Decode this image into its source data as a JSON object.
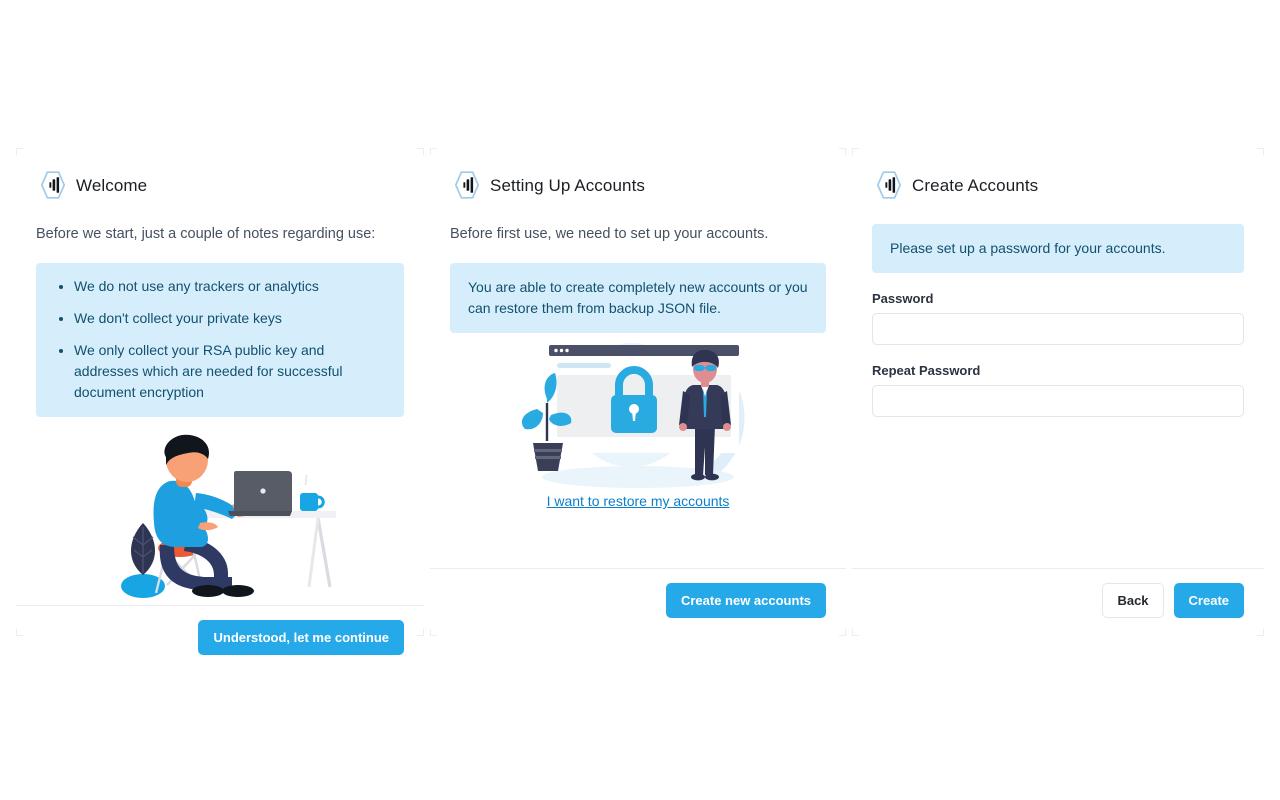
{
  "colors": {
    "primary": "#26a9e8",
    "alert_bg": "#d6eefb",
    "alert_text": "#12506f",
    "link": "#0b7fc7",
    "text": "#44515f",
    "heading": "#1b1f23",
    "input_border": "#e2e5e9",
    "divider": "#eaecef",
    "illus_dark": "#2f3452",
    "illus_navy": "#373d61",
    "illus_blue": "#29abe2",
    "illus_skin": "#f8a076",
    "illus_denim": "#2f3a64",
    "illus_shirt": "#1e9fe0",
    "illus_gray": "#575c67",
    "illus_orange": "#ea5b35"
  },
  "panels": [
    {
      "id": "welcome",
      "logo_icon": "hexagon-signal-logo-icon",
      "title": "Welcome",
      "lead": "Before we start, just a couple of notes regarding use:",
      "alert_items": [
        "We do not use any trackers or analytics",
        "We don't collect your private keys",
        "We only collect your RSA public key and addresses which are needed for successful document encryption"
      ],
      "illustration": "person-working-at-desk-illustration",
      "primary_button": "Understood, let me continue"
    },
    {
      "id": "setup",
      "logo_icon": "hexagon-signal-logo-icon",
      "title": "Setting Up Accounts",
      "lead": "Before first use, we need to set up your accounts.",
      "alert_text": "You are able to create completely new accounts or you can restore them from backup JSON file.",
      "illustration": "security-lock-browser-illustration",
      "restore_link": "I want to restore my accounts",
      "primary_button": "Create new accounts"
    },
    {
      "id": "create",
      "logo_icon": "hexagon-signal-logo-icon",
      "title": "Create Accounts",
      "alert_text": "Please set up a password for your accounts.",
      "fields": [
        {
          "label": "Password",
          "value": "",
          "placeholder": ""
        },
        {
          "label": "Repeat Password",
          "value": "",
          "placeholder": ""
        }
      ],
      "back_button": "Back",
      "primary_button": "Create"
    }
  ]
}
